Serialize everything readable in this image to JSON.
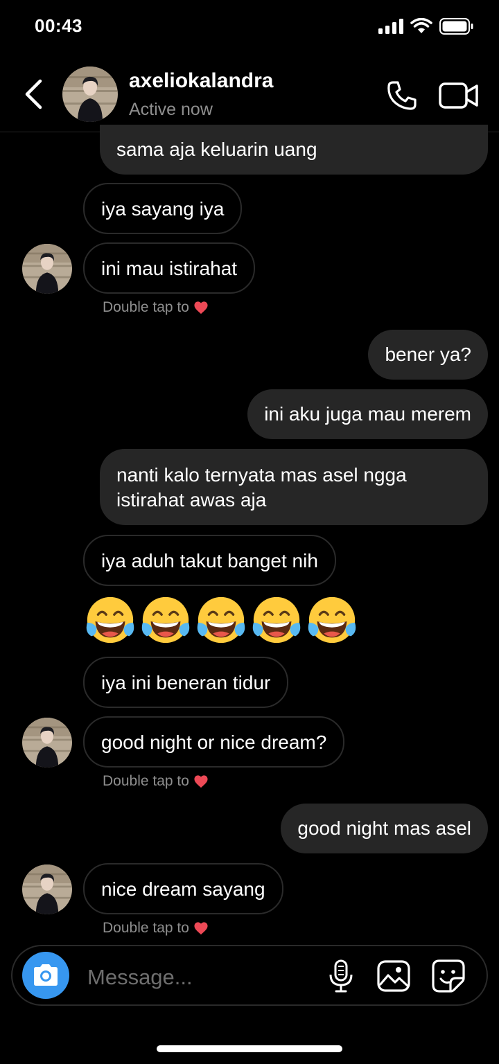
{
  "status_bar": {
    "time": "00:43"
  },
  "header": {
    "username": "axeliokalandra",
    "status": "Active now",
    "icons": {
      "back": "chevron-left-icon",
      "call": "phone-icon",
      "video": "video-camera-icon"
    }
  },
  "messages": [
    {
      "side": "sent",
      "text": "sama aja keluarin uang"
    },
    {
      "side": "received",
      "text": "iya sayang iya"
    },
    {
      "side": "received",
      "text": "ini mau istirahat"
    },
    {
      "side": "sent",
      "text": "bener ya?"
    },
    {
      "side": "sent",
      "text": "ini aku juga mau merem"
    },
    {
      "side": "sent",
      "text": "nanti kalo ternyata mas asel ngga istirahat awas aja"
    },
    {
      "side": "received",
      "text": "iya aduh takut banget nih"
    },
    {
      "side": "received",
      "text": "😂😂😂😂😂"
    },
    {
      "side": "received",
      "text": "iya ini beneran tidur"
    },
    {
      "side": "received",
      "text": "good night or nice dream?"
    },
    {
      "side": "sent",
      "text": "good night mas asel"
    },
    {
      "side": "received",
      "text": "nice dream sayang"
    }
  ],
  "hints": [
    "Double tap to",
    "Double tap to",
    "Double tap to"
  ],
  "composer": {
    "placeholder": "Message...",
    "icons": {
      "camera": "camera-icon",
      "mic": "microphone-icon",
      "gallery": "image-icon",
      "sticker": "sticker-icon"
    }
  },
  "colors": {
    "accent": "#3797f0",
    "sent_bubble": "#262626",
    "heart": "#ed4956"
  }
}
